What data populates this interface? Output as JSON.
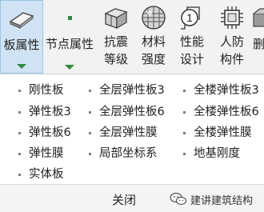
{
  "toolbar": {
    "buttons": [
      {
        "label_line1": "板属性",
        "icon": "slab-icon"
      },
      {
        "label_line1": "节点属性",
        "icon": "node-dot-icon"
      },
      {
        "label_line1": "抗震",
        "label_line2": "等级",
        "icon": "building-block-icon"
      },
      {
        "label_line1": "材料",
        "label_line2": "强度",
        "icon": "material-sphere-icon"
      },
      {
        "label_line1": "性能",
        "label_line2": "设计",
        "icon": "performance-number-icon",
        "icon_text": "1"
      },
      {
        "label_line1": "人防",
        "label_line2": "构件",
        "icon": "chip-icon"
      },
      {
        "label_line1": "删",
        "icon": "delete-icon"
      }
    ]
  },
  "options": {
    "col1": [
      "刚性板",
      "弹性板3",
      "弹性板6",
      "弹性膜",
      "实体板"
    ],
    "col2": [
      "全层弹性板3",
      "全层弹性板6",
      "全层弹性膜",
      "局部坐标系"
    ],
    "col3": [
      "全楼弹性板3",
      "全楼弹性板6",
      "全楼弹性膜",
      "地基刚度"
    ]
  },
  "footer": {
    "close_label": "关闭",
    "watermark": "建讲建筑结构"
  },
  "colors": {
    "toolbar_bg": "#f2f2f2",
    "active_bg": "#cfe3f4",
    "arrow_green": "#2e8b3a"
  }
}
